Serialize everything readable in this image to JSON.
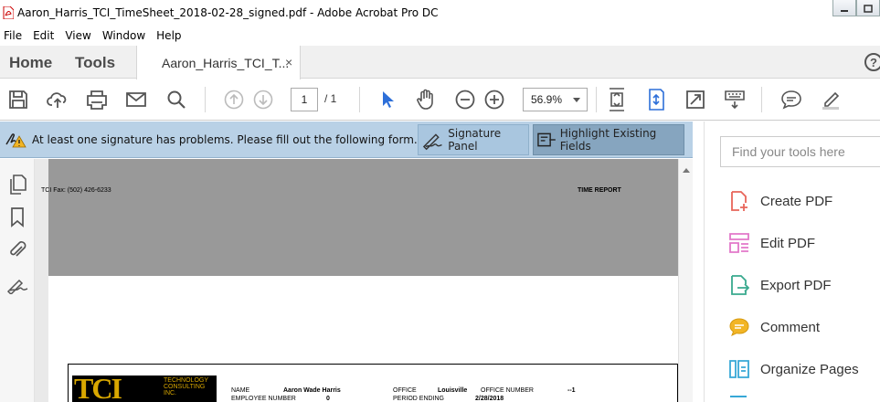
{
  "window": {
    "title": "Aaron_Harris_TCI_TimeSheet_2018-02-28_signed.pdf - Adobe Acrobat Pro DC"
  },
  "menu": [
    "File",
    "Edit",
    "View",
    "Window",
    "Help"
  ],
  "tabs": {
    "home": "Home",
    "tools": "Tools",
    "document": "Aaron_Harris_TCI_T...",
    "close": "×",
    "help": "?"
  },
  "toolbar": {
    "page_current": "1",
    "page_total": "/ 1",
    "zoom": "56.9%"
  },
  "signature_bar": {
    "message": "At least one signature has problems.  Please fill out the following form.",
    "signature_panel": "Signature Panel",
    "highlight_fields": "Highlight Existing Fields"
  },
  "document": {
    "fax": "TCI  Fax: (502) 426-6233",
    "report_title": "TIME REPORT",
    "logo_big": "TCI",
    "logo_small": "TECHNOLOGY CONSULTING INC.",
    "fields": {
      "name_label": "NAME",
      "name_value": "Aaron Wade Harris",
      "emp_label": "EMPLOYEE NUMBER",
      "emp_value": "0",
      "office_label": "OFFICE",
      "office_value": "Louisville",
      "office_num_label": "OFFICE NUMBER",
      "office_num_value": "--1",
      "period_label": "PERIOD ENDING",
      "period_value": "2/28/2018"
    }
  },
  "tools_pane": {
    "search_placeholder": "Find your tools here",
    "items": [
      "Create PDF",
      "Edit PDF",
      "Export PDF",
      "Comment",
      "Organize Pages"
    ]
  },
  "colors": {
    "acrobat_red": "#e0301e",
    "select_blue": "#2d6fd9",
    "sigbar_bg": "#b9d1e6",
    "tool_create": "#e8655a",
    "tool_edit": "#e277c9",
    "tool_export": "#39a98e",
    "tool_comment": "#f2b525",
    "tool_organize": "#37a8d6"
  }
}
